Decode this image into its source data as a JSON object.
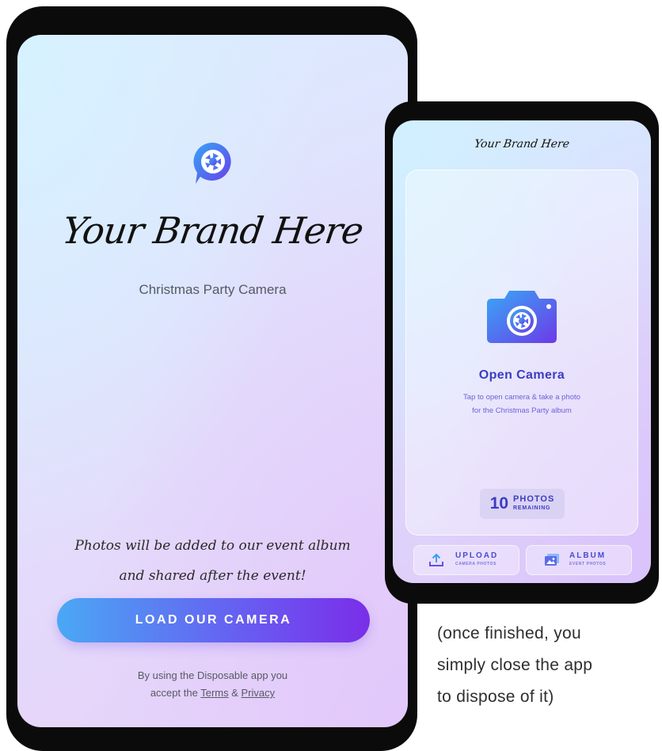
{
  "left_phone": {
    "brand": "Your Brand Here",
    "subtitle": "Christmas Party Camera",
    "album_note_line1": "Photos will be added to our event album",
    "album_note_line2": "and shared after the event!",
    "load_button": "LOAD OUR CAMERA",
    "legal_line1": "By using the Disposable app you",
    "legal_prefix": "accept the",
    "legal_terms": "Terms",
    "legal_amp": "&",
    "legal_privacy": "Privacy"
  },
  "right_phone": {
    "brand": "Your Brand Here",
    "open_title": "Open Camera",
    "open_desc_line1": "Tap to open camera & take a photo",
    "open_desc_line2": "for the Christmas Party album",
    "remaining_count": "10",
    "remaining_top": "PHOTOS",
    "remaining_bottom": "REMAINING",
    "upload_label": "UPLOAD",
    "upload_sub": "CAMERA PHOTOS",
    "album_label": "ALBUM",
    "album_sub": "EVENT PHOTOS"
  },
  "caption": {
    "line1": "(once finished, you",
    "line2": "simply close the app",
    "line3": "to dispose of it)"
  },
  "colors": {
    "accent_blue": "#4aa8f4",
    "accent_purple": "#7a2ee8",
    "indigo_text": "#3b3cc2"
  },
  "icons": [
    "shutter-logo-icon",
    "camera-shutter-icon",
    "upload-icon",
    "album-icon"
  ]
}
